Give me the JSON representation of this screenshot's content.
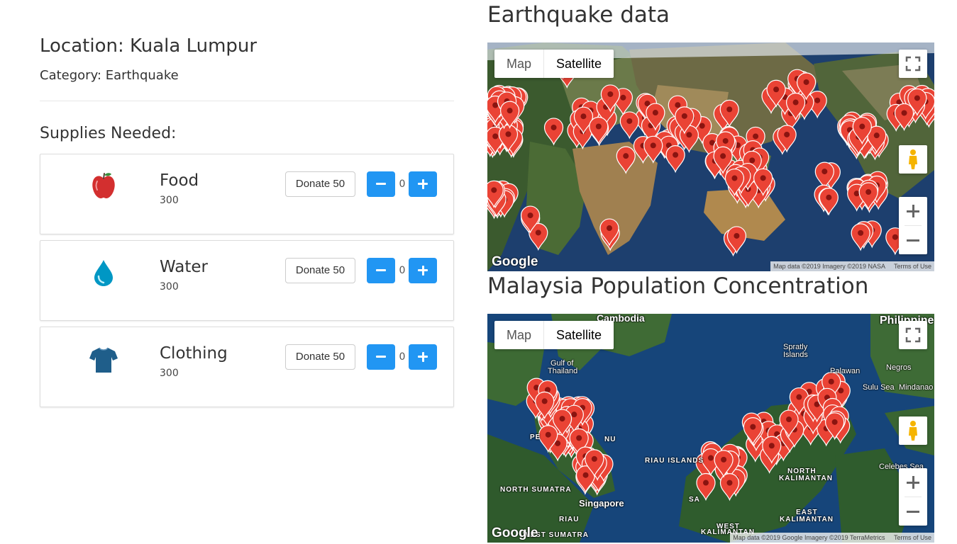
{
  "location": {
    "label": "Location: Kuala Lumpur"
  },
  "category": {
    "label": "Category: Earthquake"
  },
  "supplies_title": "Supplies Needed:",
  "supplies": [
    {
      "name": "Food",
      "amount": "300",
      "donate_label": "Donate 50",
      "count": "0",
      "icon": "apple-icon"
    },
    {
      "name": "Water",
      "amount": "300",
      "donate_label": "Donate 50",
      "count": "0",
      "icon": "water-drop-icon"
    },
    {
      "name": "Clothing",
      "amount": "300",
      "donate_label": "Donate 50",
      "count": "0",
      "icon": "tshirt-icon"
    }
  ],
  "maps": [
    {
      "title": "Earthquake data",
      "type_map": "Map",
      "type_satellite": "Satellite",
      "attribution": "Map data ©2019 Imagery ©2019 NASA",
      "terms": "Terms of Use",
      "logo": "Google"
    },
    {
      "title": "Malaysia Population Concentration",
      "type_map": "Map",
      "type_satellite": "Satellite",
      "attribution": "Map data ©2019 Google Imagery ©2019 TerraMetrics",
      "terms": "Terms of Use",
      "logo": "Google",
      "place_labels": {
        "cambodia": "Cambodia",
        "philippines": "Philippine",
        "spratly": "Spratly",
        "islands": "Islands",
        "gulf": "Gulf of",
        "thailand": "Thailand",
        "palawan": "Palawan",
        "negros": "Negros",
        "sulu_sea": "Sulu Sea",
        "mindanao": "Mindanao",
        "riau_islands": "RIAU ISLANDS",
        "celebes_sea": "Celebes Sea",
        "north_kalimantan": "NORTH",
        "kalimantan": "KALIMANTAN",
        "north_sumatra": "NORTH SUMATRA",
        "singapore": "Singapore",
        "riau": "RIAU",
        "east": "EAST",
        "kalimantan2": "KALIMANTAN",
        "west": "WEST",
        "west_kalimantan": "KALIMANTAN",
        "west_sumatra": "WEST SUMATRA",
        "pe": "PE",
        "nu": "NU",
        "sa": "SA"
      }
    }
  ],
  "colors": {
    "accent": "#2196f3",
    "marker": "#e53935",
    "ocean": "#1d3f6e"
  }
}
